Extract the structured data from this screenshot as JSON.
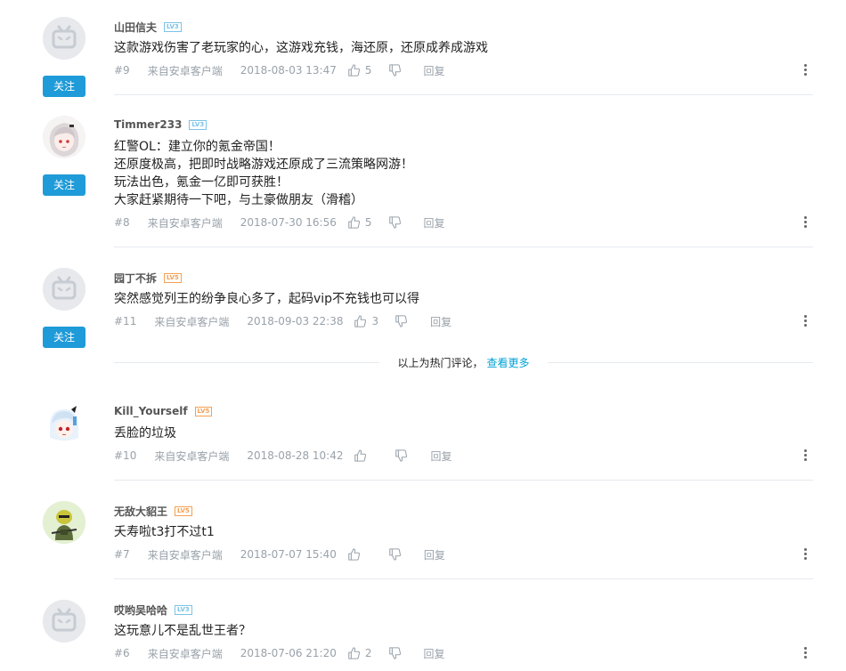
{
  "follow_label": "关注",
  "reply_label": "回复",
  "hot_divider": {
    "text": "以上为热门评论，",
    "link": "查看更多"
  },
  "comments": [
    {
      "username": "山田信夫",
      "level": "LV3",
      "lines": [
        "这款游戏伤害了老玩家的心，这游戏充钱，海还原，还原成养成游戏"
      ],
      "floor": "#9",
      "device": "来自安卓客户端",
      "time": "2018-08-03 13:47",
      "likes": "5",
      "avatar": "default-tv-icon",
      "follow": true
    },
    {
      "username": "Timmer233",
      "level": "LV3",
      "lines": [
        "红警OL：建立你的氪金帝国！",
        "还原度极高，把即时战略游戏还原成了三流策略网游！",
        "玩法出色，氪金一亿即可获胜！",
        "大家赶紧期待一下吧，与土豪做朋友（滑稽）"
      ],
      "floor": "#8",
      "device": "来自安卓客户端",
      "time": "2018-07-30 16:56",
      "likes": "5",
      "avatar": "anime-girl-avatar",
      "follow": true
    },
    {
      "username": "园丁不拆",
      "level": "LV5",
      "lines": [
        "突然感觉列王的纷争良心多了，起码vip不充钱也可以得"
      ],
      "floor": "#11",
      "device": "来自安卓客户端",
      "time": "2018-09-03 22:38",
      "likes": "3",
      "avatar": "default-tv-icon",
      "follow": true
    },
    {
      "username": "Kill_Yourself",
      "level": "LV5",
      "lines": [
        "丢脸的垃圾"
      ],
      "floor": "#10",
      "device": "来自安卓客户端",
      "time": "2018-08-28 10:42",
      "likes": "",
      "avatar": "anime-boy-avatar",
      "follow": false
    },
    {
      "username": "无敌大貂王",
      "level": "LV5",
      "lines": [
        "夭寿啦t3打不过t1"
      ],
      "floor": "#7",
      "device": "来自安卓客户端",
      "time": "2018-07-07 15:40",
      "likes": "",
      "avatar": "soldier-avatar",
      "follow": false
    },
    {
      "username": "哎哟吴哈哈",
      "level": "LV3",
      "lines": [
        "这玩意儿不是乱世王者？"
      ],
      "floor": "#6",
      "device": "来自安卓客户端",
      "time": "2018-07-06 21:20",
      "likes": "2",
      "avatar": "default-tv-icon",
      "follow": false
    }
  ]
}
